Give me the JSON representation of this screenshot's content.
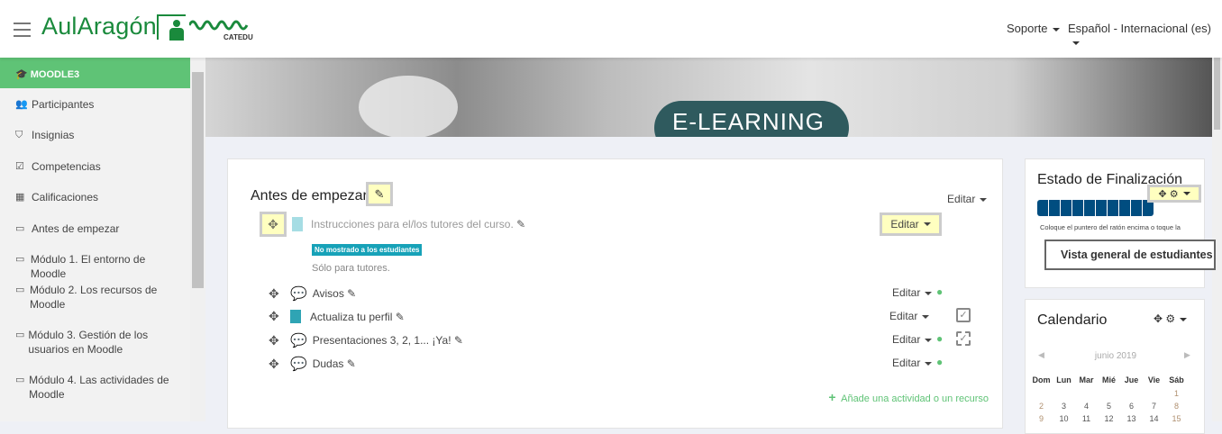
{
  "header": {
    "logo": "AulAragón",
    "logo_sub": "CATEDU",
    "support": "Soporte",
    "language": "Español - Internacional (es)"
  },
  "sidebar": {
    "course": "MOODLE3",
    "items": [
      {
        "label": "Participantes",
        "icon": "users-icon"
      },
      {
        "label": "Insignias",
        "icon": "shield-icon"
      },
      {
        "label": "Competencias",
        "icon": "checkbox-icon"
      },
      {
        "label": "Calificaciones",
        "icon": "table-icon"
      },
      {
        "label": "Antes de empezar",
        "icon": "folder-icon"
      },
      {
        "label": "Módulo 1. El entorno de Moodle",
        "icon": "folder-icon"
      },
      {
        "label": "Módulo 2. Los recursos de Moodle",
        "icon": "folder-icon"
      },
      {
        "label": "Módulo 3. Gestión de los usuarios en Moodle",
        "icon": "folder-icon"
      },
      {
        "label": "Módulo 4. Las actividades de Moodle",
        "icon": "folder-icon"
      }
    ]
  },
  "banner": {
    "text": "E-LEARNING"
  },
  "section": {
    "title": "Antes de empezar",
    "edit": "Editar",
    "hidden_item": {
      "title": "Instrucciones para el/los tutores del curso.",
      "edit": "Editar",
      "badge": "No mostrado a los estudiantes",
      "note": "Sólo para tutores."
    },
    "activities": [
      {
        "title": "Avisos",
        "type": "forum",
        "edit": "Editar",
        "user": true,
        "check": ""
      },
      {
        "title": "Actualiza tu perfil",
        "type": "page",
        "edit": "Editar",
        "user": false,
        "check": "manual"
      },
      {
        "title": "Presentaciones 3, 2, 1... ¡Ya!",
        "type": "forum",
        "edit": "Editar",
        "user": true,
        "check": "auto"
      },
      {
        "title": "Dudas",
        "type": "forum",
        "edit": "Editar",
        "user": true,
        "check": ""
      }
    ],
    "add": "Añade una actividad o un recurso"
  },
  "completion": {
    "title": "Estado de Finalización",
    "blocks": 10,
    "hint": "Coloque el puntero del ratón encima o toque la",
    "button": "Vista general de estudiantes"
  },
  "calendar": {
    "title": "Calendario",
    "month": "junio 2019",
    "days": [
      "Dom",
      "Lun",
      "Mar",
      "Mié",
      "Jue",
      "Vie",
      "Sáb"
    ],
    "weeks": [
      [
        "",
        "",
        "",
        "",
        "",
        "",
        "1"
      ],
      [
        "2",
        "3",
        "4",
        "5",
        "6",
        "7",
        "8"
      ],
      [
        "9",
        "10",
        "11",
        "12",
        "13",
        "14",
        "15"
      ]
    ]
  },
  "colors": {
    "green": "#5fc376",
    "brand": "#1a8a3c",
    "progress": "#004d80",
    "badge": "#17a2b8"
  }
}
